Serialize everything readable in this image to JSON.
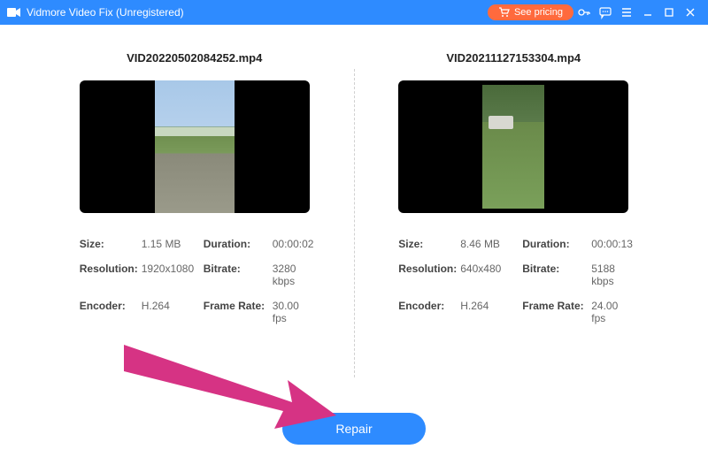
{
  "titlebar": {
    "app_name": "Vidmore Video Fix (Unregistered)",
    "pricing_label": "See pricing"
  },
  "left_video": {
    "filename": "VID20220502084252.mp4",
    "size_label": "Size:",
    "size_value": "1.15 MB",
    "duration_label": "Duration:",
    "duration_value": "00:00:02",
    "resolution_label": "Resolution:",
    "resolution_value": "1920x1080",
    "bitrate_label": "Bitrate:",
    "bitrate_value": "3280 kbps",
    "encoder_label": "Encoder:",
    "encoder_value": "H.264",
    "framerate_label": "Frame Rate:",
    "framerate_value": "30.00 fps"
  },
  "right_video": {
    "filename": "VID20211127153304.mp4",
    "size_label": "Size:",
    "size_value": "8.46 MB",
    "duration_label": "Duration:",
    "duration_value": "00:00:13",
    "resolution_label": "Resolution:",
    "resolution_value": "640x480",
    "bitrate_label": "Bitrate:",
    "bitrate_value": "5188 kbps",
    "encoder_label": "Encoder:",
    "encoder_value": "H.264",
    "framerate_label": "Frame Rate:",
    "framerate_value": "24.00 fps"
  },
  "footer": {
    "repair_label": "Repair"
  }
}
